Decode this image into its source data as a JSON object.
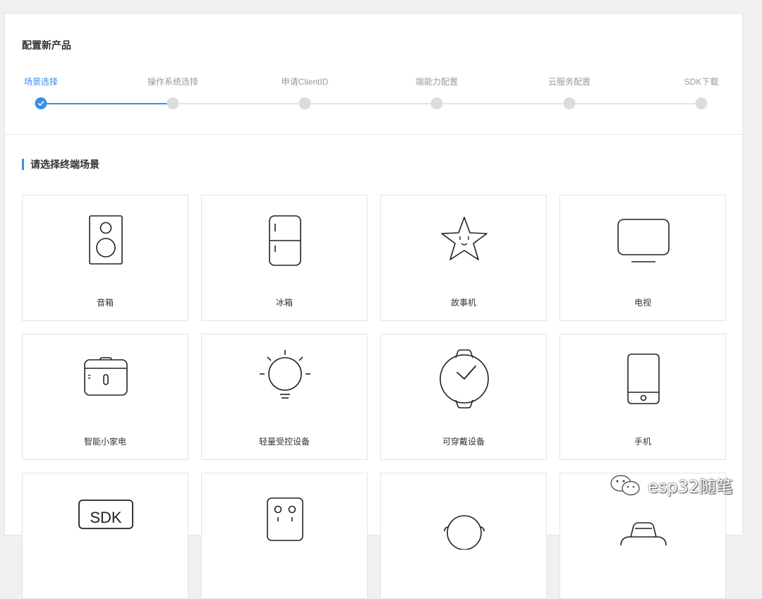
{
  "page": {
    "title": "配置新产品"
  },
  "steps": [
    {
      "label": "场景选择",
      "state": "active"
    },
    {
      "label": "操作系统选择",
      "state": "pending"
    },
    {
      "label": "申请ClientID",
      "state": "pending"
    },
    {
      "label": "端能力配置",
      "state": "pending"
    },
    {
      "label": "云服务配置",
      "state": "pending"
    },
    {
      "label": "SDK下载",
      "state": "pending"
    }
  ],
  "section": {
    "title": "请选择终端场景"
  },
  "scenes": [
    {
      "label": "音箱",
      "icon": "speaker-icon"
    },
    {
      "label": "冰箱",
      "icon": "fridge-icon"
    },
    {
      "label": "故事机",
      "icon": "star-icon"
    },
    {
      "label": "电视",
      "icon": "tv-icon"
    },
    {
      "label": "智能小家电",
      "icon": "small-appliance-icon"
    },
    {
      "label": "轻量受控设备",
      "icon": "light-bulb-icon"
    },
    {
      "label": "可穿戴设备",
      "icon": "watch-icon"
    },
    {
      "label": "手机",
      "icon": "phone-icon"
    },
    {
      "label": "",
      "icon": "sdk-icon",
      "icon_text": "SDK"
    },
    {
      "label": "",
      "icon": "robot-face-icon"
    },
    {
      "label": "",
      "icon": "headset-icon"
    },
    {
      "label": "",
      "icon": "car-icon"
    }
  ],
  "watermark": {
    "text": "esp32随笔",
    "icon": "wechat-icon"
  },
  "colors": {
    "accent": "#3a8ee6",
    "pending": "#dcdcdc"
  }
}
